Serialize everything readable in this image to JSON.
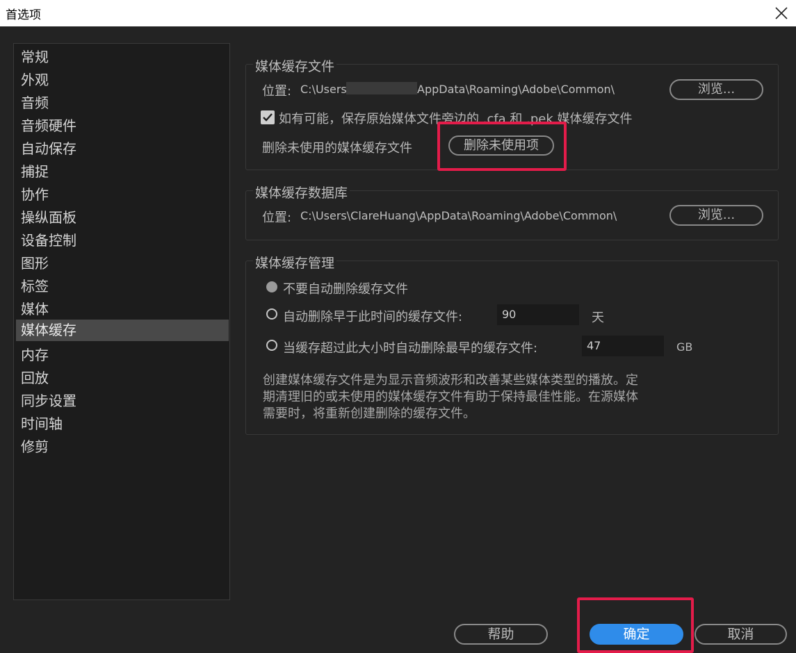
{
  "window": {
    "title": "首选项",
    "close_icon": "close-icon"
  },
  "sidebar": {
    "items": [
      {
        "label": "常规"
      },
      {
        "label": "外观"
      },
      {
        "label": "音频"
      },
      {
        "label": "音频硬件"
      },
      {
        "label": "自动保存"
      },
      {
        "label": "捕捉"
      },
      {
        "label": "协作"
      },
      {
        "label": "操纵面板"
      },
      {
        "label": "设备控制"
      },
      {
        "label": "图形"
      },
      {
        "label": "标签"
      },
      {
        "label": "媒体"
      },
      {
        "label": "媒体缓存",
        "selected": true
      },
      {
        "label": "内存"
      },
      {
        "label": "回放"
      },
      {
        "label": "同步设置"
      },
      {
        "label": "时间轴"
      },
      {
        "label": "修剪"
      }
    ]
  },
  "media_cache_files": {
    "legend": "媒体缓存文件",
    "location_label": "位置:",
    "path_prefix": "C:\\Users\\",
    "path_suffix": "AppData\\Roaming\\Adobe\\Common\\",
    "browse_label": "浏览...",
    "save_beside_originals": {
      "checked": true,
      "label": "如有可能，保存原始媒体文件旁边的 .cfa 和 .pek 媒体缓存文件"
    },
    "delete_unused_label": "删除未使用的媒体缓存文件",
    "delete_unused_button": "删除未使用项"
  },
  "media_cache_db": {
    "legend": "媒体缓存数据库",
    "location_label": "位置:",
    "path": "C:\\Users\\ClareHuang\\AppData\\Roaming\\Adobe\\Common\\",
    "browse_label": "浏览..."
  },
  "media_cache_management": {
    "legend": "媒体缓存管理",
    "options": [
      {
        "label": "不要自动删除缓存文件",
        "selected": true
      },
      {
        "label": "自动删除早于此时间的缓存文件:",
        "value": "90",
        "unit": "天"
      },
      {
        "label": "当缓存超过此大小时自动删除最早的缓存文件:",
        "value": "47",
        "unit": "GB"
      }
    ],
    "description_lines": [
      "创建媒体缓存文件是为显示音频波形和改善某些媒体类型的播放。定",
      "期清理旧的或未使用的媒体缓存文件有助于保持最佳性能。在源媒体",
      "需要时，将重新创建删除的缓存文件。"
    ]
  },
  "footer": {
    "help": "帮助",
    "ok": "确定",
    "cancel": "取消"
  },
  "colors": {
    "highlight": "#e31c4a",
    "primary": "#2f8cea"
  }
}
